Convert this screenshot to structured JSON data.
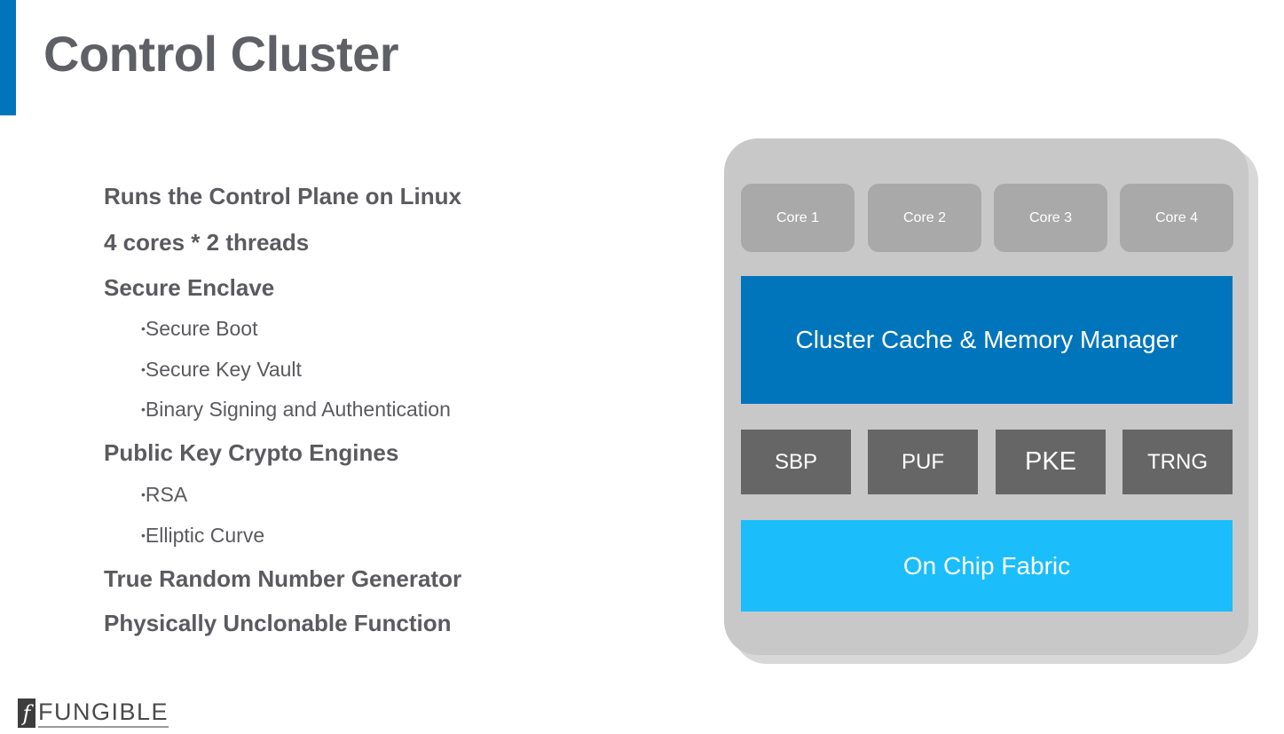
{
  "slide": {
    "title": "Control Cluster",
    "accent_color": "#0075bb"
  },
  "bullets": [
    {
      "level": 1,
      "text": "Runs the Control Plane on Linux"
    },
    {
      "level": 1,
      "text": "4 cores * 2 threads"
    },
    {
      "level": 1,
      "text": "Secure Enclave"
    },
    {
      "level": 2,
      "text": "Secure Boot"
    },
    {
      "level": 2,
      "text": "Secure Key Vault"
    },
    {
      "level": 2,
      "text": "Binary Signing and Authentication"
    },
    {
      "level": 1,
      "text": "Public Key Crypto Engines"
    },
    {
      "level": 2,
      "text": "RSA"
    },
    {
      "level": 2,
      "text": "Elliptic Curve"
    },
    {
      "level": 1,
      "text": "True Random Number Generator"
    },
    {
      "level": 1,
      "text": "Physically Unclonable Function"
    }
  ],
  "bullet_glyph": "•",
  "diagram": {
    "cores": [
      "Core 1",
      "Core 2",
      "Core 3",
      "Core 4"
    ],
    "cache": "Cluster Cache & Memory Manager",
    "engines": [
      "SBP",
      "PUF",
      "PKE",
      "TRNG"
    ],
    "fabric": "On Chip Fabric",
    "colors": {
      "container": "#c8c8c8",
      "core": "#a9a9a9",
      "cache": "#0075bb",
      "engine": "#666666",
      "fabric": "#1bbdfb"
    }
  },
  "logo": {
    "mark": "f",
    "text": "FUNGIBLE"
  }
}
